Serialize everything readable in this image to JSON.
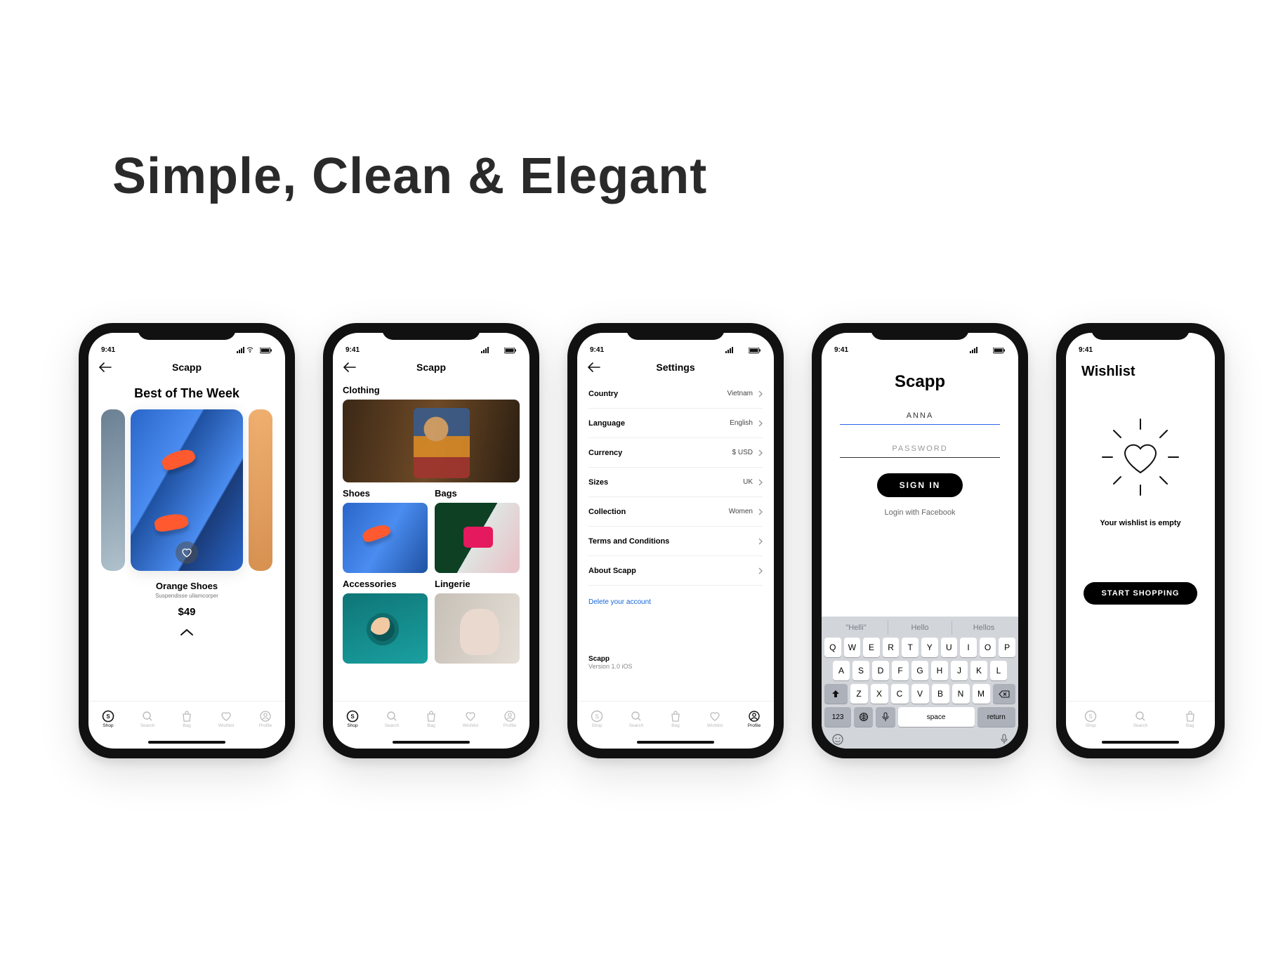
{
  "hero": "Simple, Clean & Elegant",
  "status_time": "9:41",
  "tabs": {
    "shop": "Shop",
    "search": "Search",
    "bag": "Bag",
    "wishlist": "Wishlist",
    "profile": "Profile"
  },
  "phone1": {
    "header": "Scapp",
    "title": "Best of The Week",
    "product": {
      "name": "Orange Shoes",
      "sub": "Suspendisse ullamcorper",
      "price": "$49"
    }
  },
  "phone2": {
    "header": "Scapp",
    "cats": {
      "clothing": "Clothing",
      "shoes": "Shoes",
      "bags": "Bags",
      "accessories": "Accessories",
      "lingerie": "Lingerie"
    }
  },
  "phone3": {
    "header": "Settings",
    "rows": [
      {
        "label": "Country",
        "value": "Vietnam"
      },
      {
        "label": "Language",
        "value": "English"
      },
      {
        "label": "Currency",
        "value": "$ USD"
      },
      {
        "label": "Sizes",
        "value": "UK"
      },
      {
        "label": "Collection",
        "value": "Women"
      },
      {
        "label": "Terms and Conditions",
        "value": ""
      },
      {
        "label": "About Scapp",
        "value": ""
      }
    ],
    "delete": "Delete your account",
    "app_name": "Scapp",
    "app_ver": "Version 1.0 iOS"
  },
  "phone4": {
    "brand": "Scapp",
    "user": "ANNA",
    "pass_placeholder": "PASSWORD",
    "signin": "SIGN IN",
    "facebook": "Login with Facebook",
    "suggestions": [
      "\"Helli\"",
      "Hello",
      "Hellos"
    ],
    "rows": [
      [
        "Q",
        "W",
        "E",
        "R",
        "T",
        "Y",
        "U",
        "I",
        "O",
        "P"
      ],
      [
        "A",
        "S",
        "D",
        "F",
        "G",
        "H",
        "J",
        "K",
        "L"
      ],
      [
        "Z",
        "X",
        "C",
        "V",
        "B",
        "N",
        "M"
      ]
    ],
    "numkey": "123",
    "space": "space",
    "return": "return"
  },
  "phone5": {
    "title": "Wishlist",
    "empty": "Your wishlist is empty",
    "button": "START SHOPPING"
  }
}
